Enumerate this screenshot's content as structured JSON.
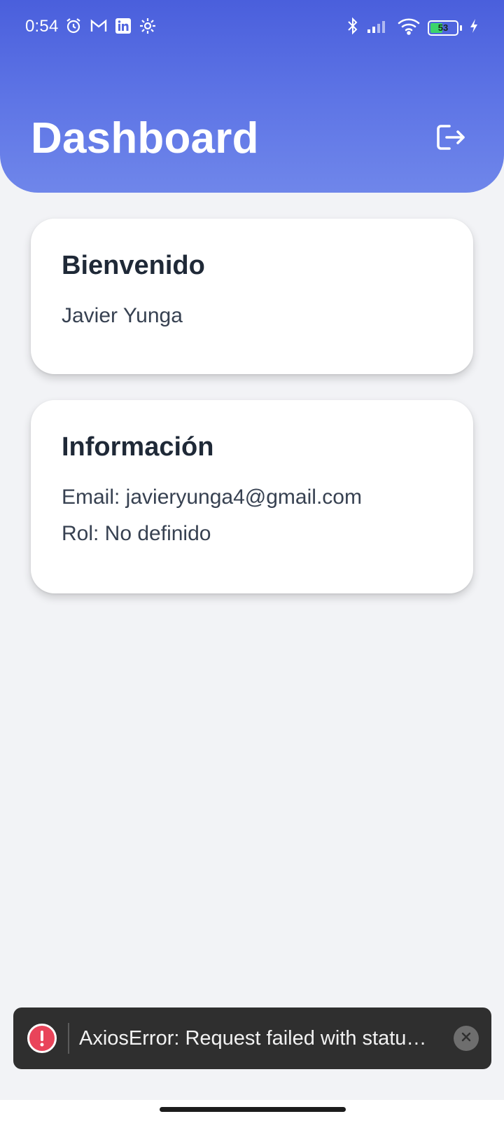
{
  "status_bar": {
    "time": "0:54",
    "left_icons": [
      "alarm-icon",
      "gmail-icon",
      "linkedin-icon",
      "settings-icon"
    ],
    "right_icons": [
      "bluetooth-icon",
      "signal-icon",
      "wifi-icon",
      "battery-icon",
      "charging-icon"
    ],
    "battery_level": "53",
    "battery_fraction": 0.53
  },
  "header": {
    "title": "Dashboard",
    "logout_icon": "logout-icon",
    "gradient_colors": [
      "#4a5fdc",
      "#6f86ea"
    ]
  },
  "welcome_card": {
    "title": "Bienvenido",
    "user_name": "Javier Yunga"
  },
  "info_card": {
    "title": "Información",
    "email_line": "Email: javieryunga4@gmail.com",
    "role_line": "Rol: No definido"
  },
  "toast": {
    "message": "AxiosError: Request failed with statu…",
    "icon": "error-icon",
    "close_icon": "close-icon",
    "accent_color": "#e9445a"
  }
}
